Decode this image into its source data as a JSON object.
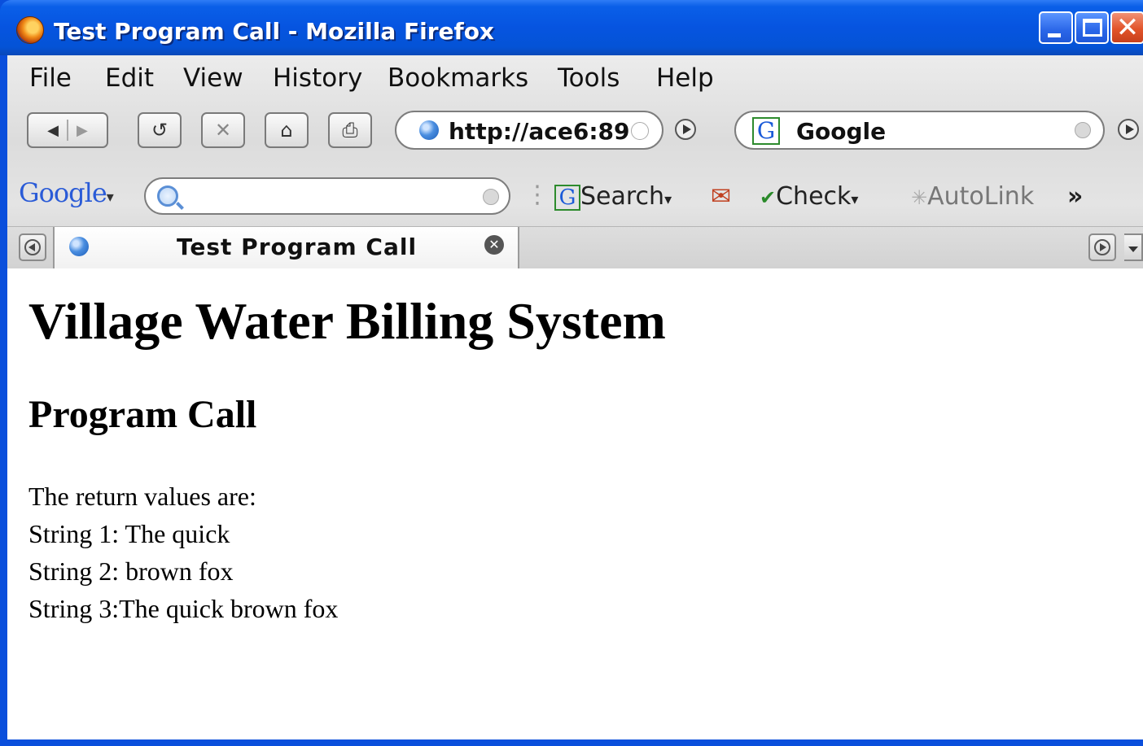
{
  "window": {
    "title": "Test Program Call - Mozilla Firefox",
    "accent": "#0a4fdc"
  },
  "menu": {
    "items": [
      "File",
      "Edit",
      "View",
      "History",
      "Bookmarks",
      "Tools",
      "Help"
    ]
  },
  "navigation": {
    "url": "http://ace6:89",
    "search_engine": "Google"
  },
  "google_toolbar": {
    "logo": "Google",
    "search_label": "Search",
    "check_label": "Check",
    "autolink_label": "AutoLink",
    "overflow": "»"
  },
  "tabs": [
    {
      "label": "Test Program Call"
    }
  ],
  "page": {
    "heading": "Village Water Billing System",
    "subheading": "Program Call",
    "lines": [
      "The return values are:",
      "String 1: The quick",
      "String 2: brown fox",
      "String 3:The quick brown fox"
    ]
  }
}
